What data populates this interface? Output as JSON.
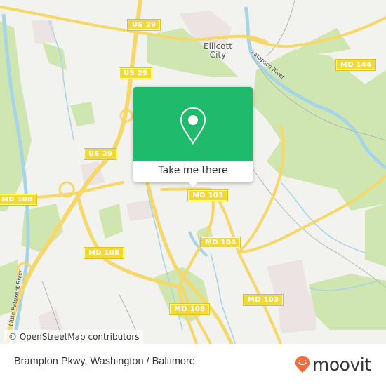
{
  "map": {
    "place_labels": [
      {
        "name": "Ellicott",
        "line2": "City"
      }
    ],
    "river_labels": [
      "Patapsco River",
      "Little Patuxent River"
    ],
    "road_shields": [
      {
        "label": "US 29"
      },
      {
        "label": "US 29"
      },
      {
        "label": "US 29"
      },
      {
        "label": "MD 144"
      },
      {
        "label": "MD 103"
      },
      {
        "label": "MD 108"
      },
      {
        "label": "MD 108"
      },
      {
        "label": "MD 104"
      },
      {
        "label": "MD 103"
      },
      {
        "label": "MD 108"
      }
    ],
    "attribution": "© OpenStreetMap contributors"
  },
  "popup": {
    "icon": "map-pin-icon",
    "action_label": "Take me there",
    "accent_color": "#1fba6b"
  },
  "footer": {
    "location_title": "Brampton Pkwy, Washington / Baltimore",
    "brand": "moovit",
    "brand_color": "#f26b3a"
  }
}
